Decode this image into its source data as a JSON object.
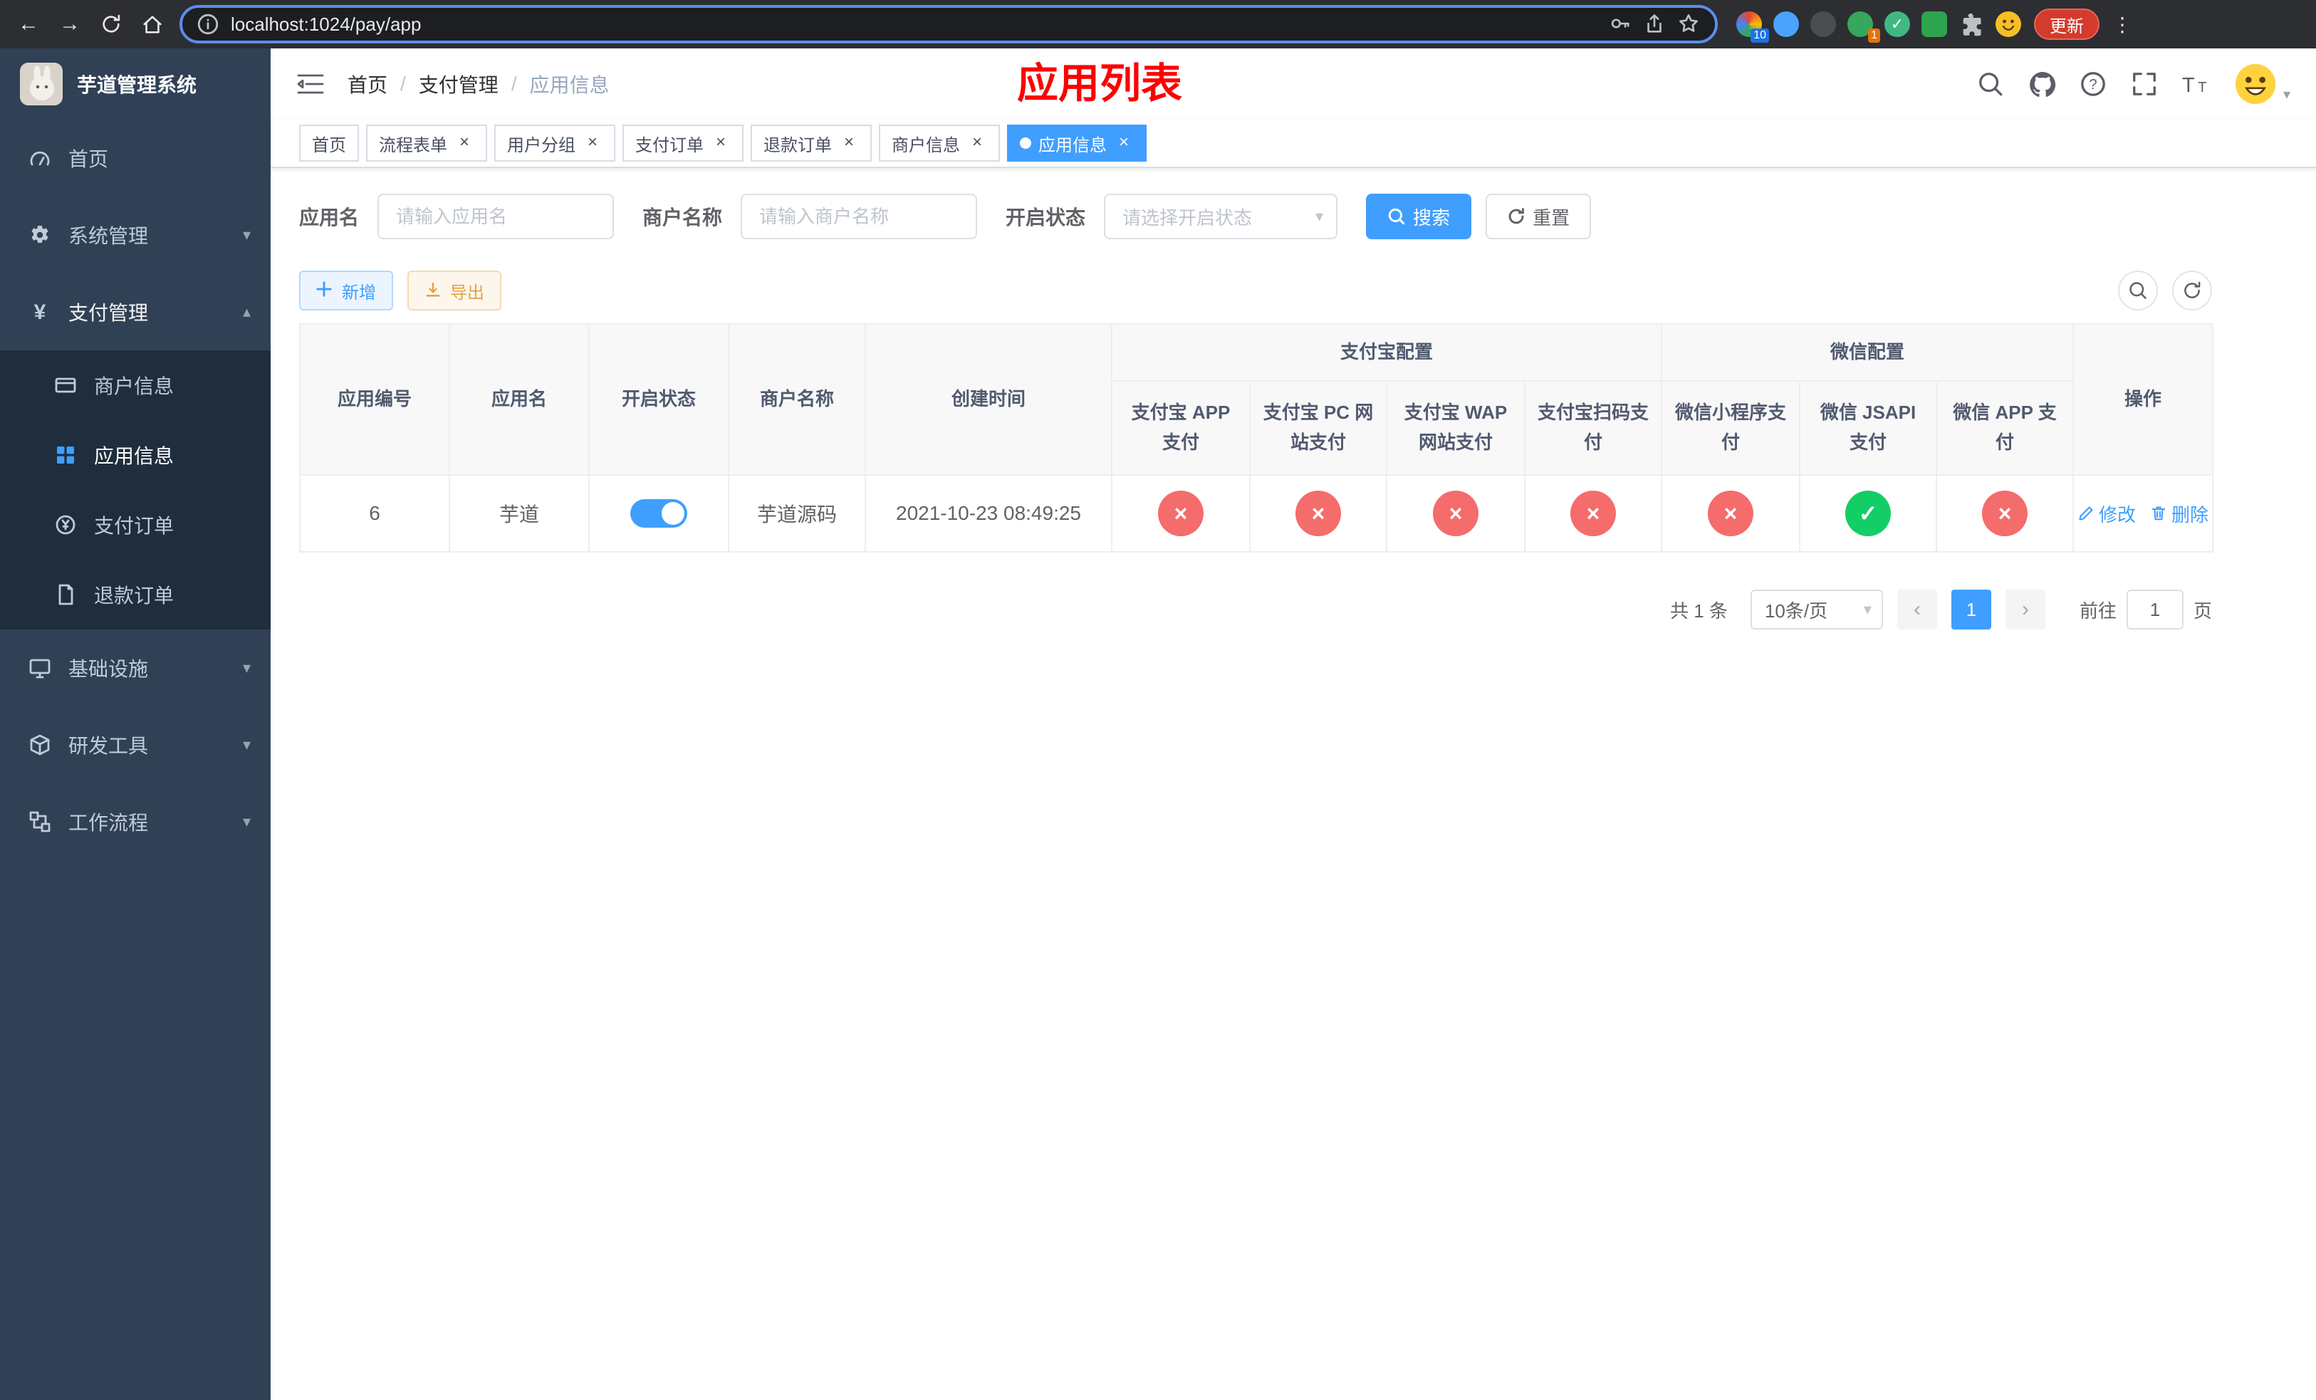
{
  "colors": {
    "primary": "#409eff",
    "success": "#13ce66",
    "danger": "#f56c6c",
    "warning": "#e6a23c",
    "annotation_red": "#fe0000",
    "sidebar_bg": "#304156",
    "submenu_bg": "#1f2d3d"
  },
  "icons": {
    "chevron_down": "▾",
    "chevron_up": "▴",
    "caret_down": "▾",
    "close": "×",
    "prev": "‹",
    "next": "›",
    "check": "✓",
    "cross": "×",
    "breadcrumb_separator": "/",
    "info": "i",
    "question": "?"
  },
  "browser": {
    "url": "localhost:1024/pay/app",
    "update_label": "更新",
    "extension_badge_count": "10",
    "extension_badge_one": "1"
  },
  "sidebar": {
    "title": "芋道管理系统",
    "items": [
      {
        "label": "首页"
      },
      {
        "label": "系统管理"
      },
      {
        "label": "支付管理"
      },
      {
        "label": "基础设施"
      },
      {
        "label": "研发工具"
      },
      {
        "label": "工作流程"
      }
    ],
    "payment_children": [
      {
        "label": "商户信息"
      },
      {
        "label": "应用信息"
      },
      {
        "label": "支付订单"
      },
      {
        "label": "退款订单"
      }
    ]
  },
  "header": {
    "breadcrumb": [
      "首页",
      "支付管理",
      "应用信息"
    ],
    "annotation": "应用列表"
  },
  "tabs": [
    {
      "label": "首页",
      "closable": false,
      "active": false
    },
    {
      "label": "流程表单",
      "closable": true,
      "active": false
    },
    {
      "label": "用户分组",
      "closable": true,
      "active": false
    },
    {
      "label": "支付订单",
      "closable": true,
      "active": false
    },
    {
      "label": "退款订单",
      "closable": true,
      "active": false
    },
    {
      "label": "商户信息",
      "closable": true,
      "active": false
    },
    {
      "label": "应用信息",
      "closable": true,
      "active": true
    }
  ],
  "filters": {
    "app_name": {
      "label": "应用名",
      "placeholder": "请输入应用名",
      "value": ""
    },
    "merchant": {
      "label": "商户名称",
      "placeholder": "请输入商户名称",
      "value": ""
    },
    "status": {
      "label": "开启状态",
      "placeholder": "请选择开启状态",
      "value": ""
    },
    "search_label": "搜索",
    "reset_label": "重置"
  },
  "toolbar": {
    "add_label": "新增",
    "export_label": "导出"
  },
  "table": {
    "group_headers": {
      "alipay": "支付宝配置",
      "wechat": "微信配置"
    },
    "columns": [
      "应用编号",
      "应用名",
      "开启状态",
      "商户名称",
      "创建时间",
      "支付宝 APP 支付",
      "支付宝 PC 网站支付",
      "支付宝 WAP 网站支付",
      "支付宝扫码支付",
      "微信小程序支付",
      "微信 JSAPI 支付",
      "微信 APP 支付",
      "操作"
    ],
    "rows": [
      {
        "id": "6",
        "name": "芋道",
        "enabled": true,
        "merchant": "芋道源码",
        "created_at": "2021-10-23 08:49:25",
        "channels": [
          false,
          false,
          false,
          false,
          false,
          true,
          false
        ],
        "actions": {
          "edit": "修改",
          "delete": "删除"
        }
      }
    ]
  },
  "pagination": {
    "total_text": "共 1 条",
    "page_size_text": "10条/页",
    "current_page": "1",
    "goto_label": "前往",
    "goto_value": "1",
    "page_unit_label": "页"
  }
}
